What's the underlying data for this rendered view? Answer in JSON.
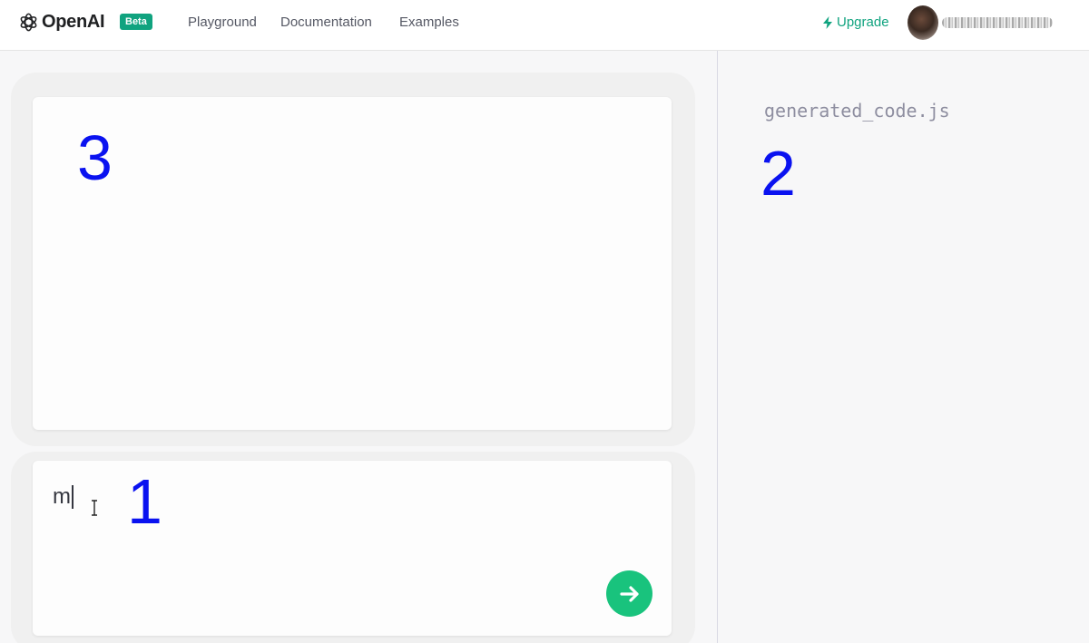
{
  "header": {
    "brand": "OpenAI",
    "badge": "Beta",
    "nav": [
      "Playground",
      "Documentation",
      "Examples"
    ],
    "upgrade_label": "Upgrade"
  },
  "colors": {
    "accent": "#10a37f",
    "send_button": "#19c37d",
    "annotation": "#0a12f0"
  },
  "icons": {
    "logo": "openai-logo-icon",
    "upgrade": "lightning-icon",
    "send": "arrow-right-icon",
    "cursor": "text-cursor-icon"
  },
  "output_panel": {
    "annotation": "3"
  },
  "input_panel": {
    "value": "m",
    "annotation": "1"
  },
  "code_panel": {
    "filename": "generated_code.js",
    "annotation": "2"
  }
}
